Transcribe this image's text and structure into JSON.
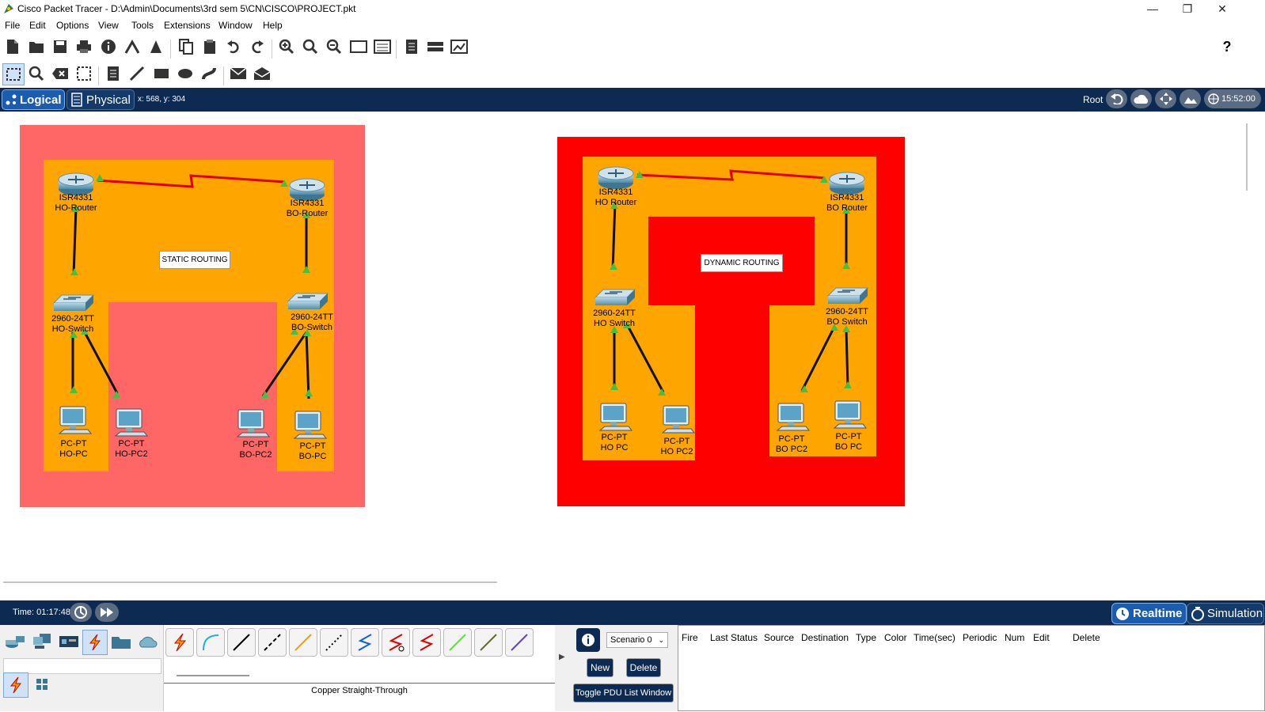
{
  "window": {
    "title": "Cisco Packet Tracer - D:\\Admin\\Documents\\3rd sem 5\\CN\\CISCO\\PROJECT.pkt",
    "minimize": "—",
    "restore": "❐",
    "close": "✕"
  },
  "menu": [
    "File",
    "Edit",
    "Options",
    "View",
    "Tools",
    "Extensions",
    "Window",
    "Help"
  ],
  "help_icon": "?",
  "view_bar": {
    "logical_label": "Logical",
    "physical_label": "Physical",
    "coords": "x: 568, y: 304",
    "root_label": "Root",
    "clock": "15:52:00"
  },
  "networks": {
    "static": {
      "title": "STATIC ROUTING",
      "bg_color": "#ff6666",
      "inner_color": "#ffa500",
      "ho_router": {
        "model": "ISR4331",
        "name": "HO-Router"
      },
      "bo_router": {
        "model": "ISR4331",
        "name": "BO-Router"
      },
      "ho_switch": {
        "model": "2960-24TT",
        "name": "HO-Switch"
      },
      "bo_switch": {
        "model": "2960-24TT",
        "name": "BO-Switch"
      },
      "pcs": [
        {
          "model": "PC-PT",
          "name": "HO-PC"
        },
        {
          "model": "PC-PT",
          "name": "HO-PC2"
        },
        {
          "model": "PC-PT",
          "name": "BO-PC2"
        },
        {
          "model": "PC-PT",
          "name": "BO-PC"
        }
      ]
    },
    "dynamic": {
      "title": "DYNAMIC ROUTING",
      "bg_color": "#ff0000",
      "inner_color": "#ffa500",
      "ho_router": {
        "model": "ISR4331",
        "name": "HO Router"
      },
      "bo_router": {
        "model": "ISR4331",
        "name": "BO Router"
      },
      "ho_switch": {
        "model": "2960-24TT",
        "name": "HO Switch"
      },
      "bo_switch": {
        "model": "2960-24TT",
        "name": "BO Switch"
      },
      "pcs": [
        {
          "model": "PC-PT",
          "name": "HO PC"
        },
        {
          "model": "PC-PT",
          "name": "HO PC2"
        },
        {
          "model": "PC-PT",
          "name": "BO PC2"
        },
        {
          "model": "PC-PT",
          "name": "BO PC"
        }
      ]
    }
  },
  "time_bar": {
    "time": "Time: 01:17:48",
    "realtime_label": "Realtime",
    "simulation_label": "Simulation"
  },
  "bottom": {
    "selected_cable": "Copper Straight-Through",
    "scenario": "Scenario 0",
    "new_label": "New",
    "delete_label": "Delete",
    "toggle_label": "Toggle PDU List Window",
    "pdu_columns": [
      "Fire",
      "Last Status",
      "Source",
      "Destination",
      "Type",
      "Color",
      "Time(sec)",
      "Periodic",
      "Num",
      "Edit",
      "Delete"
    ]
  }
}
